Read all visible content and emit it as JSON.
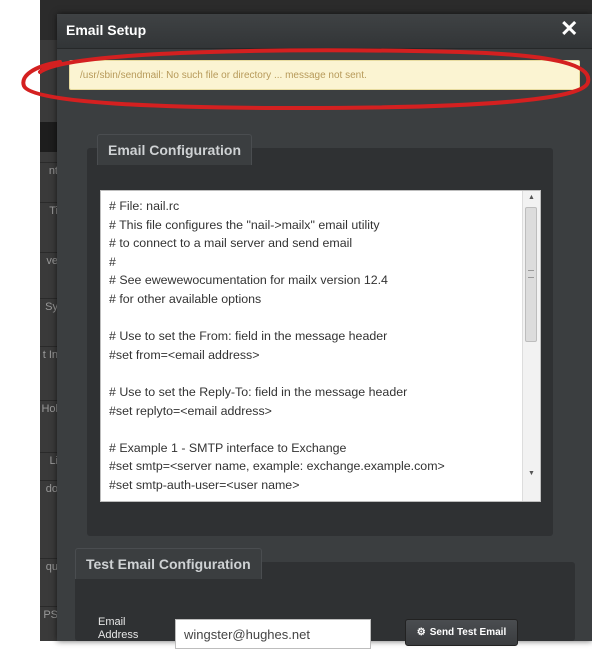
{
  "background": {
    "sidebar_fragments": [
      "nt",
      "Ti",
      "ve",
      "Sy",
      "t In",
      "Hol",
      "Li",
      "do",
      "qu",
      "PS"
    ]
  },
  "modal": {
    "title": "Email Setup",
    "close_glyph": "✕"
  },
  "alert": {
    "message": "/usr/sbin/sendmail: No such file or directory ... message not sent."
  },
  "email_configuration": {
    "heading": "Email Configuration",
    "content": "# File: nail.rc\n# This file configures the \"nail->mailx\" email utility\n# to connect to a mail server and send email\n#\n# See ewewewocumentation for mailx version 12.4\n# for other available options\n\n# Use to set the From: field in the message header\n#set from=<email address>\n\n# Use to set the Reply-To: field in the message header\n#set replyto=<email address>\n\n# Example 1 - SMTP interface to Exchange\n#set smtp=<server name, example: exchange.example.com>\n#set smtp-auth-user=<user name>"
  },
  "test_email": {
    "heading": "Test Email Configuration",
    "label": "Email\nAddress",
    "address_value": "wingster@hughes.net",
    "send_button_label": "Send Test Email",
    "send_button_icon": "gear-icon"
  },
  "colors": {
    "annotation_red": "#d42020",
    "alert_bg": "#fbf4d2"
  }
}
